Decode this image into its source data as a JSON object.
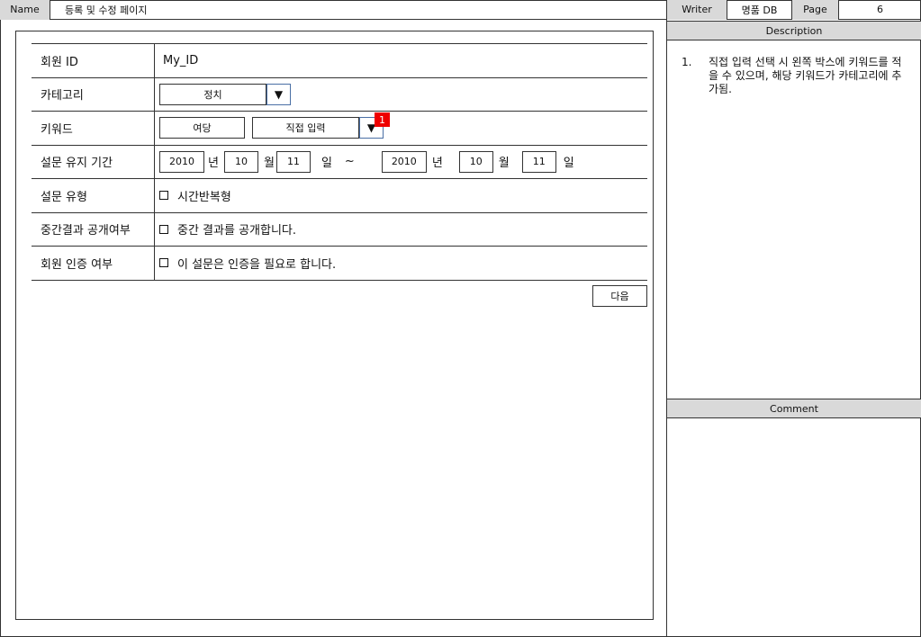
{
  "header": {
    "name_label": "Name",
    "name_value": "등록 및 수정 페이지",
    "writer_label": "Writer",
    "writer_value": "명품 DB",
    "page_label": "Page",
    "page_value": "6"
  },
  "description": {
    "title": "Description",
    "items": [
      {
        "num": "1.",
        "text": "직접 입력 선택 시 왼쪽 박스에 키워드를 적을 수 있으며, 해당 키워드가 카테고리에 추가됨."
      }
    ]
  },
  "comment": {
    "title": "Comment"
  },
  "form": {
    "member_id": {
      "label": "회원 ID",
      "value": "My_ID"
    },
    "category": {
      "label": "카테고리",
      "value": "정치",
      "arrow": "▼"
    },
    "keyword": {
      "label": "키워드",
      "value": "여당",
      "select_value": "직접 입력",
      "arrow": "▼"
    },
    "period": {
      "label": "설문 유지 기간",
      "start_year": "2010",
      "year_unit": "년",
      "start_month": "10",
      "month_unit": "월",
      "start_day": "11",
      "day_unit": "일",
      "tilde": "~",
      "end_year": "2010",
      "end_month": "10",
      "end_day": "11"
    },
    "survey_type": {
      "label": "설문 유형",
      "option": "시간반복형"
    },
    "interim": {
      "label": "중간결과 공개여부",
      "option": "중간 결과를 공개합니다."
    },
    "auth": {
      "label": "회원 인증 여부",
      "option": "이 설문은 인증을 필요로 합니다."
    },
    "next_button": "다음"
  },
  "marker": "1"
}
